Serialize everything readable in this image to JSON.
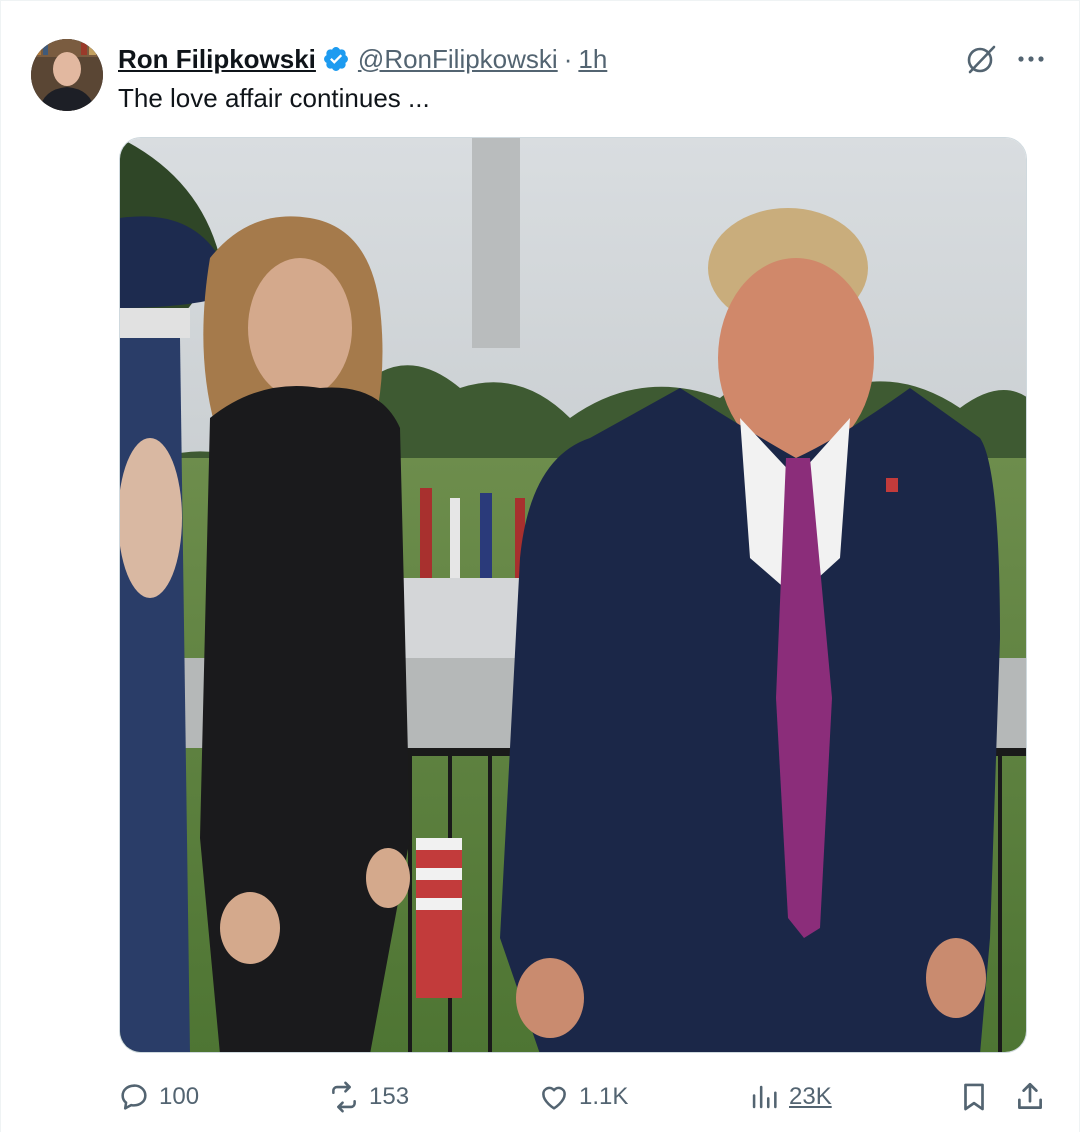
{
  "tweet": {
    "author_name": "Ron Filipkowski",
    "handle": "@RonFilipkowski",
    "separator": "·",
    "time": "1h",
    "text": "The love affair continues ..."
  },
  "media": {
    "icon": "photo"
  },
  "actions": {
    "replies": "100",
    "reposts": "153",
    "likes": "1.1K",
    "views": "23K"
  },
  "colors": {
    "verified": "#1d9bf0",
    "muted": "#536471",
    "text": "#0f1419"
  }
}
